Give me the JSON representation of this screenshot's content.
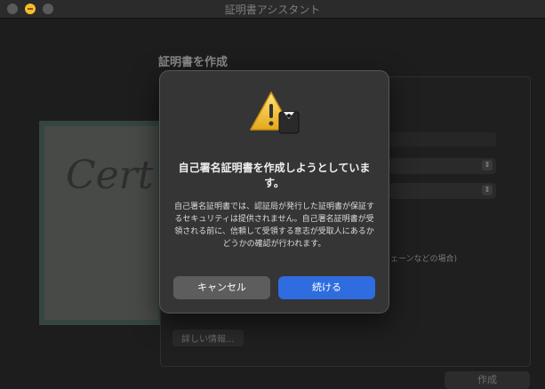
{
  "window": {
    "title": "証明書アシスタント"
  },
  "background": {
    "page_title": "証明書を作成",
    "hint_text": "チェーンなどの場合)",
    "details_button": "詳しい情報...",
    "create_button": "作成",
    "cert_art_text": "Cert"
  },
  "alert": {
    "title": "自己署名証明書を作成しようとしています。",
    "body": "自己署名証明書では、認証局が発行した証明書が保証するセキュリティは提供されません。自己署名証明書が受領される前に、信頼して受領する意志が受取人にあるかどうかの確認が行われます。",
    "cancel_label": "キャンセル",
    "continue_label": "続ける",
    "icon": "warning-certificate-icon"
  },
  "colors": {
    "accent": "#2e6ce0",
    "warning": "#f2c230"
  }
}
